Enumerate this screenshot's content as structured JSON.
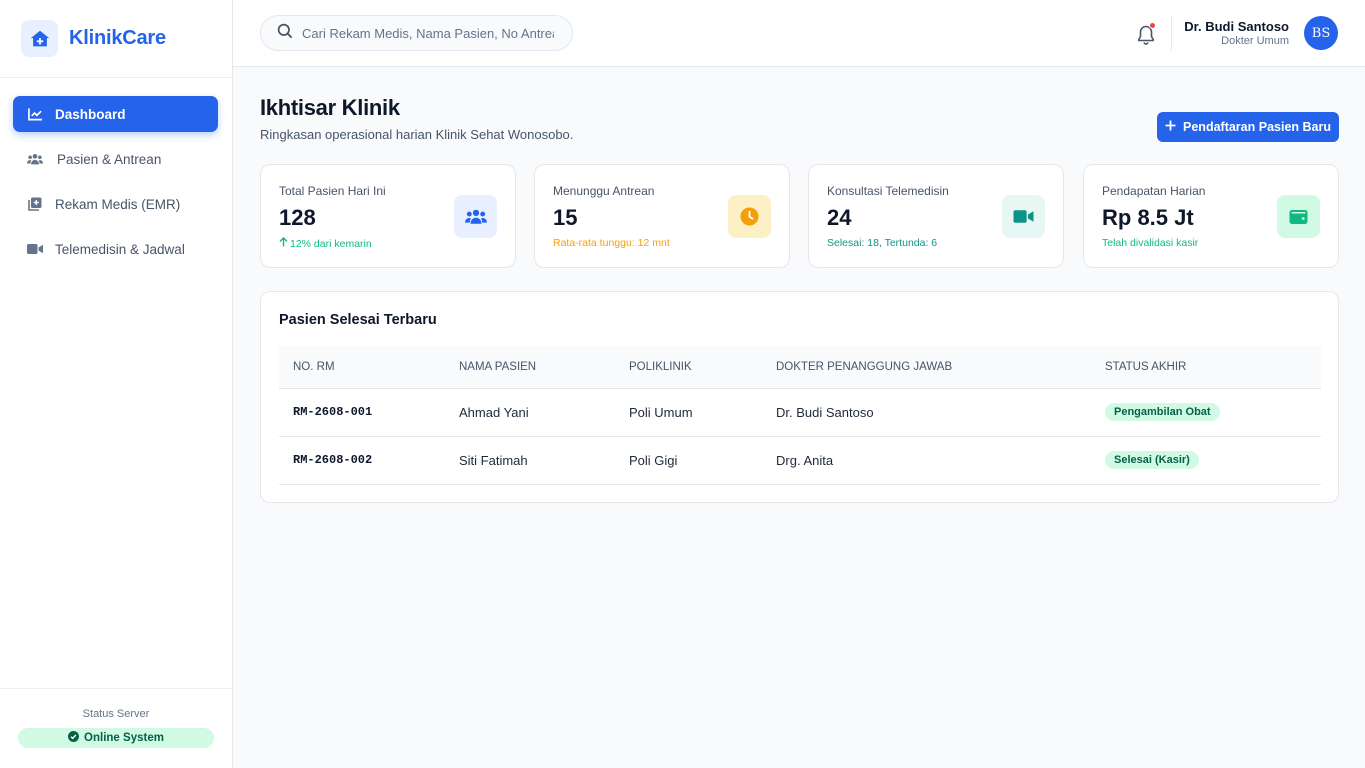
{
  "sidebar": {
    "brand": "KlinikCare",
    "items": [
      {
        "label": "Dashboard",
        "icon": "chart-line-icon",
        "active": true
      },
      {
        "label": "Pasien & Antrean",
        "icon": "users-icon"
      },
      {
        "label": "Rekam Medis (EMR)",
        "icon": "medical-record-icon"
      },
      {
        "label": "Telemedisin & Jadwal",
        "icon": "video-icon"
      }
    ],
    "footer": {
      "label": "Status Server",
      "status": "Online System"
    }
  },
  "topbar": {
    "search_placeholder": "Cari Rekam Medis, Nama Pasien, No Antrean...",
    "user_name": "Dr. Budi Santoso",
    "user_role": "Dokter Umum",
    "avatar_initials": "BS"
  },
  "main": {
    "title": "Ikhtisar Klinik",
    "subtitle": "Ringkasan operasional harian Klinik Sehat Wonosobo.",
    "primary_button": "Pendaftaran Pasien Baru",
    "cards": [
      {
        "label": "Total Pasien Hari Ini",
        "value": "128",
        "sub": "12% dari kemarin",
        "sub_color": "#10b981",
        "icon": "users-icon",
        "icon_bg": "#e8efff",
        "icon_color": "#2563eb"
      },
      {
        "label": "Menunggu Antrean",
        "value": "15",
        "sub": "Rata-rata tunggu: 12 mnt",
        "sub_color": "#f59e0b",
        "icon": "clock-icon",
        "icon_bg": "#fdf0c4",
        "icon_color": "#f59e0b"
      },
      {
        "label": "Konsultasi Telemedisin",
        "value": "24",
        "sub": "Selesai: 18, Tertunda: 6",
        "sub_color": "#0d9488",
        "icon": "video-icon",
        "icon_bg": "#e6f7f4",
        "icon_color": "#0d9488"
      },
      {
        "label": "Pendapatan Harian",
        "value": "Rp 8.5 Jt",
        "sub": "Telah divalidasi kasir",
        "sub_color": "#10b981",
        "icon": "wallet-icon",
        "icon_bg": "#d1fae5",
        "icon_color": "#10b981"
      }
    ],
    "recent": {
      "title": "Pasien Selesai Terbaru",
      "columns": [
        "NO. RM",
        "NAMA PASIEN",
        "POLIKLINIK",
        "DOKTER PENANGGUNG JAWAB",
        "STATUS AKHIR"
      ],
      "rows": [
        {
          "rm": "RM-2608-001",
          "name": "Ahmad Yani",
          "poli": "Poli Umum",
          "doctor": "Dr. Budi Santoso",
          "status": "Pengambilan Obat"
        },
        {
          "rm": "RM-2608-002",
          "name": "Siti Fatimah",
          "poli": "Poli Gigi",
          "doctor": "Drg. Anita",
          "status": "Selesai (Kasir)"
        }
      ]
    }
  }
}
